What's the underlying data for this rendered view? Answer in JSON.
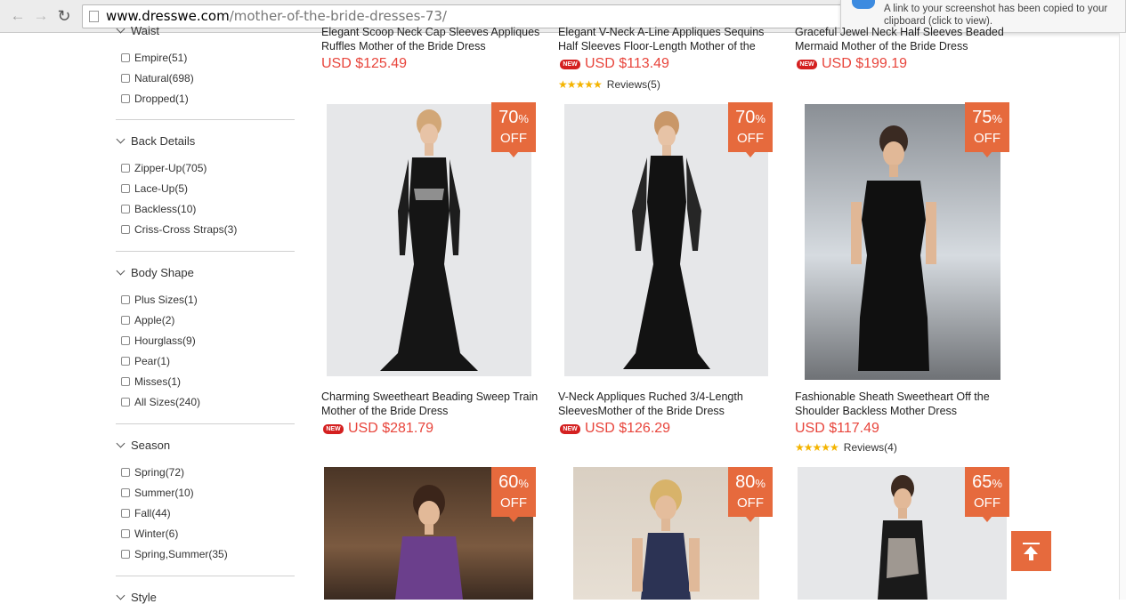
{
  "browser": {
    "url_host": "www.dresswe.com",
    "url_path": "/mother-of-the-bride-dresses-73/"
  },
  "notification": {
    "text": "A link to your screenshot has been copied to your clipboard (click to view)."
  },
  "sidebar": {
    "waist_partial_title": "Waist",
    "waist_items": [
      "Empire(51)",
      "Natural(698)",
      "Dropped(1)"
    ],
    "back_details": {
      "title": "Back Details",
      "items": [
        "Zipper-Up(705)",
        "Lace-Up(5)",
        "Backless(10)",
        "Criss-Cross Straps(3)"
      ]
    },
    "body_shape": {
      "title": "Body Shape",
      "items": [
        "Plus Sizes(1)",
        "Apple(2)",
        "Hourglass(9)",
        "Pear(1)",
        "Misses(1)",
        "All Sizes(240)"
      ]
    },
    "season": {
      "title": "Season",
      "items": [
        "Spring(72)",
        "Summer(10)",
        "Fall(44)",
        "Winter(6)",
        "Spring,Summer(35)"
      ]
    },
    "style_title": "Style"
  },
  "top_row": [
    {
      "name_line1": "Elegant Scoop Neck Cap Sleeves Appliques",
      "name_line2": "Ruffles Mother of the Bride Dress",
      "price": "USD $125.49"
    },
    {
      "name_line1": "Elegant V-Neck A-Line Appliques Sequins",
      "name_line2": "Half Sleeves Floor-Length Mother of the",
      "price": "USD $113.49",
      "new": "NEW",
      "reviews": "Reviews(5)"
    },
    {
      "name_line1": "Graceful Jewel Neck Half Sleeves Beaded",
      "name_line2": "Mermaid Mother of the Bride Dress",
      "price": "USD $199.19",
      "new": "NEW"
    }
  ],
  "middle_row": [
    {
      "discount_pct": "70",
      "discount_sign": "%",
      "discount_off": "OFF",
      "name_line1": "Charming Sweetheart Beading Sweep Train",
      "name_line2": "Mother of the Bride Dress",
      "price": "USD $281.79",
      "new": "NEW"
    },
    {
      "discount_pct": "70",
      "discount_sign": "%",
      "discount_off": "OFF",
      "name_line1": "V-Neck Appliques Ruched 3/4-Length",
      "name_line2": "SleevesMother of the Bride Dress",
      "price": "USD $126.29",
      "new": "NEW"
    },
    {
      "discount_pct": "75",
      "discount_sign": "%",
      "discount_off": "OFF",
      "name_line1": "Fashionable Sheath Sweetheart Off the",
      "name_line2": "Shoulder Backless Mother Dress",
      "price": "USD $117.49",
      "reviews": "Reviews(4)"
    }
  ],
  "bottom_row": [
    {
      "discount_pct": "60",
      "discount_sign": "%",
      "discount_off": "OFF"
    },
    {
      "discount_pct": "80",
      "discount_sign": "%",
      "discount_off": "OFF"
    },
    {
      "discount_pct": "65",
      "discount_sign": "%",
      "discount_off": "OFF"
    }
  ],
  "stars_glyph": "★★★★★",
  "colors": {
    "accent": "#e66a3d",
    "price": "#e8453c",
    "new_badge": "#d42020"
  }
}
